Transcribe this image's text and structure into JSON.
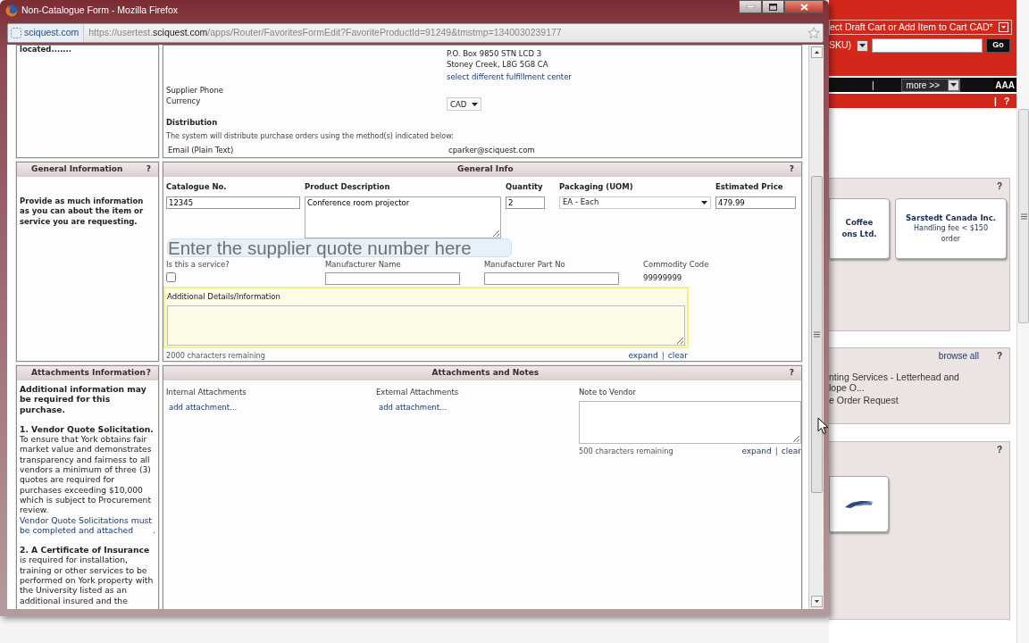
{
  "browser": {
    "title": "Non-Catalogue Form - Mozilla Firefox",
    "site": "sciquest.com",
    "url": "https://usertest.**sciquest.com**/apps/Router/FavoritesFormEdit?FavoriteProductId=91249&tmstmp=1340030239177"
  },
  "supplier": {
    "side_text": "located.......",
    "address": [
      "P.O. Box 9850 STN LCD 3",
      "Stoney Creek, L8G 5G8 CA"
    ],
    "fulfillment_link": "select different fulfillment center",
    "phone_label": "Supplier Phone",
    "currency_label": "Currency",
    "currency_value": "CAD",
    "distribution_title": "Distribution",
    "distribution_note": "The system will distribute purchase orders using the method(s) indicated below:",
    "method_label": "Email (Plain Text)",
    "method_value": "cparker@sciquest.com"
  },
  "general": {
    "side_title": "General Information",
    "side_help": "?",
    "side_text": "Provide as much information as you can about the item or service you are requesting.",
    "title": "General Info",
    "help": "?",
    "fields": [
      {
        "kind": "input",
        "label": "Catalogue No.",
        "value": "12345"
      },
      {
        "kind": "textarea",
        "label": "Product Description",
        "value": "Conference room projector"
      },
      {
        "kind": "input",
        "label": "Quantity",
        "value": "2"
      },
      {
        "kind": "select",
        "label": "Packaging (UOM)",
        "value": "EA - Each"
      },
      {
        "kind": "input",
        "label": "Estimated Price",
        "value": "479.99"
      }
    ],
    "tooltip": "Enter the supplier quote number here",
    "fields_2": [
      {
        "kind": "checkbox",
        "label": "Is this a service?",
        "checked": false
      },
      {
        "kind": "input",
        "label": "Manufacturer Name"
      },
      {
        "kind": "input",
        "label": "Manufacturer Part No"
      },
      {
        "kind": "text",
        "label": "Commodity Code",
        "value": "99999999"
      }
    ],
    "details": {
      "label": "Additional Details/Information",
      "highlighted": true,
      "remaining": "2000 characters remaining",
      "actions": [
        "expand",
        "clear"
      ],
      "separator": "|"
    }
  },
  "attachments": {
    "side_title": "Attachments Information",
    "side_help": "?",
    "side_paragraphs": [
      {
        "kind": "lead",
        "text": "Additional information may be required for this purchase."
      },
      {
        "text": "**1. Vendor Quote Solicitation.** To ensure that York obtains fair market value and demonstrates transparency and fairness to all vendors a minimum of three (3) quotes are required for purchases exceeding $10,000 which is subject to Procurement review.",
        "link": "Vendor Quote Solicitations must be completed and attached",
        "tail": " .",
        "kind": "item"
      },
      {
        "text": "**2. A Certificate of Insurance** is required for installation, training or other services to be performed on York property with the University listed as an additional insured and the",
        "kind": "item"
      }
    ],
    "title": "Attachments and Notes",
    "help": "?",
    "columns": [
      {
        "kind": "attachments",
        "label": "Internal Attachments",
        "link": "add attachment..."
      },
      {
        "kind": "attachments",
        "label": "External Attachments",
        "link": "add attachment..."
      },
      {
        "kind": "note",
        "label": "Note to Vendor",
        "remaining": "500 characters remaining",
        "actions": [
          "expand",
          "clear"
        ],
        "separator": "|"
      }
    ]
  },
  "background_page": {
    "cart_select": "ect Draft Cart or Add Item to Cart CAD*",
    "search_select": "SKU)",
    "search_button": "Go",
    "nav_separator": "|",
    "more_select": "more >>",
    "text_size_button": "AAA",
    "bar_separator": "|",
    "bar_help": "?",
    "panels": [
      {
        "kind": "suppliers",
        "help": "?",
        "cards": [
          {
            "name": "Coffee ons Ltd."
          },
          {
            "name": "Sarstedt Canada Inc.",
            "note": "Handling fee < $150 order"
          }
        ]
      },
      {
        "kind": "forms",
        "link": "browse all",
        "help": "?",
        "items": [
          "nting Services - Letterhead and lope O...",
          "e Order Request"
        ]
      },
      {
        "kind": "logos",
        "help": "?"
      }
    ]
  }
}
